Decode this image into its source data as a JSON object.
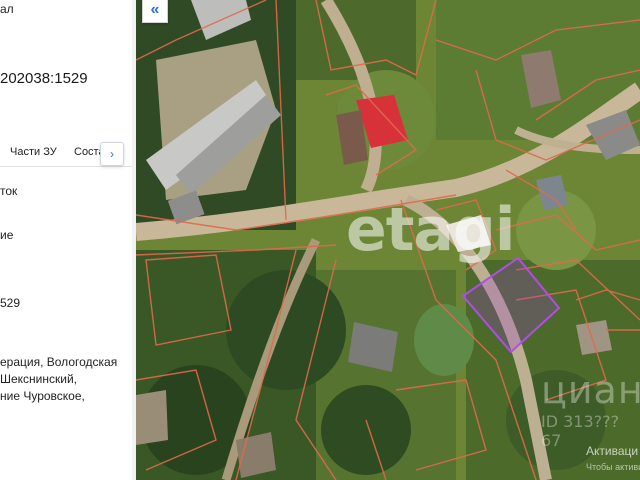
{
  "panel": {
    "top_fragment": "ал",
    "cadastral_number": "202038:1529",
    "tabs": [
      "Части ЗУ",
      "Соста"
    ],
    "tab_next": "›",
    "field_1": "ток",
    "field_2": "ие",
    "field_3": "529",
    "address_lines": [
      "ерация, Вологодская",
      "Шекснинский,",
      "ние Чуровское,"
    ]
  },
  "map": {
    "collapse_label": "«",
    "watermark_main": "etagi",
    "watermark_cian": "циан",
    "watermark_id": "ID 313??? 67",
    "windows_activation": "Активаци",
    "windows_activation_sub": "Чтобы активи",
    "colors": {
      "parcel_border": "#e06a4d",
      "highlight": "#9b3fd1",
      "road": "#c9b79a",
      "red_roof": "#d7323a"
    }
  }
}
